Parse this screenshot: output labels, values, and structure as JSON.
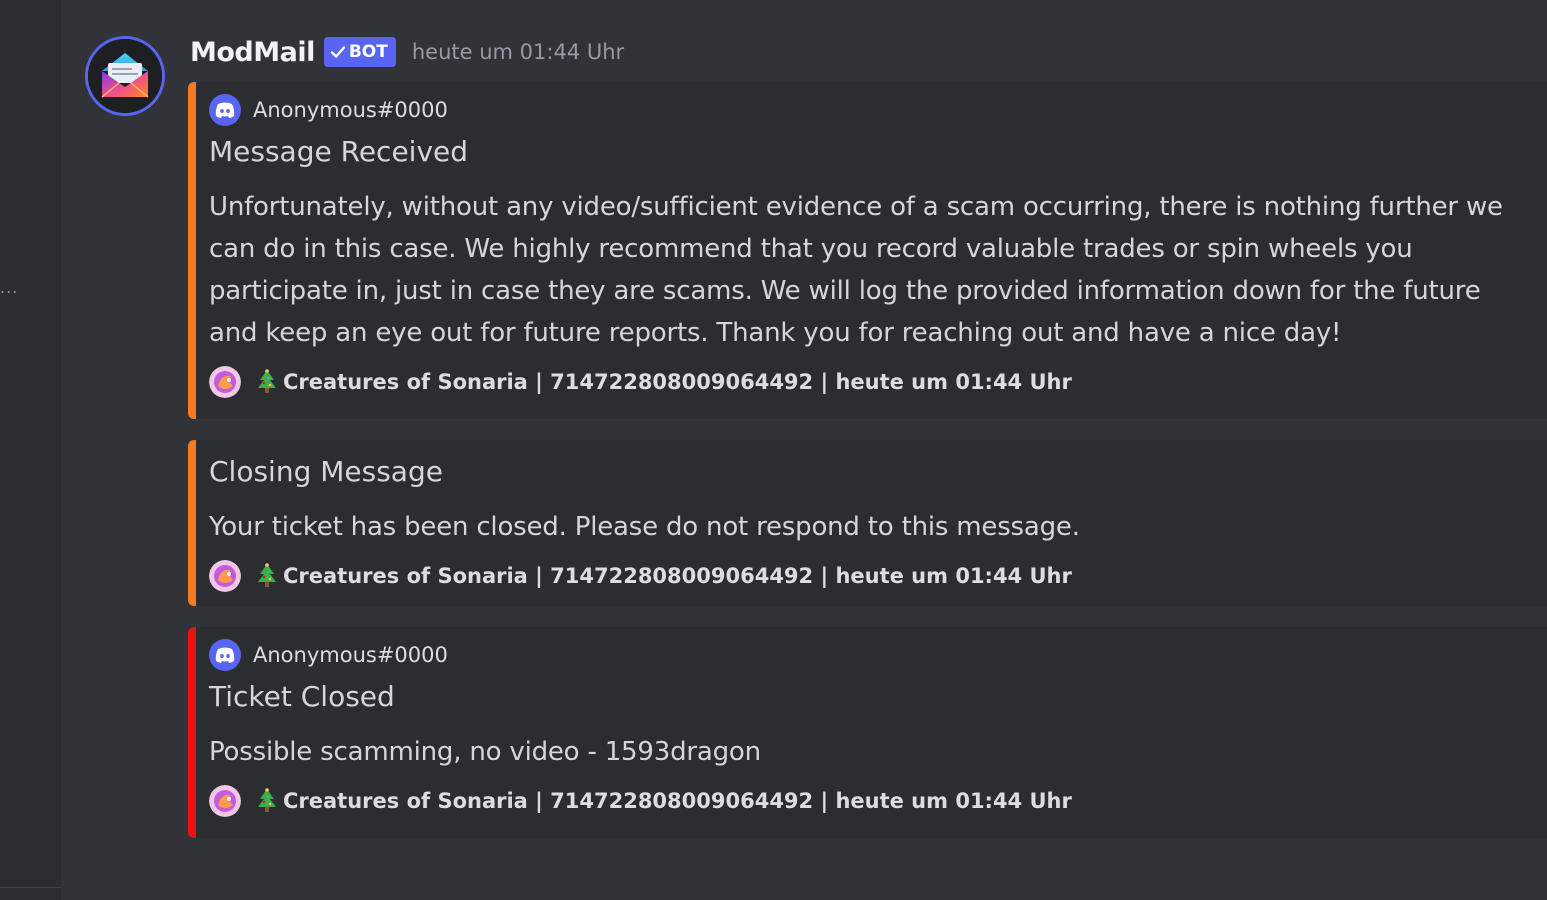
{
  "message": {
    "author": "ModMail",
    "bot_tag": "BOT",
    "timestamp": "heute um 01:44 Uhr"
  },
  "colors": {
    "accent_orange": "#f47b22",
    "accent_red": "#e8121a",
    "blurple": "#5865f2",
    "background": "#313338",
    "embed_bg": "#2b2d31"
  },
  "embeds": [
    {
      "author": "Anonymous#0000",
      "title": "Message Received",
      "description": "Unfortunately, without any video/sufficient evidence of a scam occurring, there is nothing further we can do in this case. We highly recommend that you record valuable trades or spin wheels you participate in, just in case they are scams. We will log the provided information down for the future and keep an eye out for future reports. Thank you for reaching out and have a nice day!",
      "footer": "Creatures of Sonaria | 714722808009064492 | heute um 01:44 Uhr"
    },
    {
      "title": "Closing Message",
      "description": "Your ticket has been closed. Please do not respond to this message.",
      "footer": "Creatures of Sonaria | 714722808009064492 | heute um 01:44 Uhr"
    },
    {
      "author": "Anonymous#0000",
      "title": "Ticket Closed",
      "description": "Possible scamming, no video - 1593dragon",
      "footer": "Creatures of Sonaria | 714722808009064492 | heute um 01:44 Uhr"
    }
  ],
  "icons": {
    "avatar": "mail-envelope-icon",
    "author": "discord-icon",
    "server": "server-icon",
    "footer_emoji": "christmas-tree-icon",
    "bot_check": "checkmark-icon",
    "overflow": "more-icon"
  },
  "sidebar": {
    "overflow_glyph": "..."
  }
}
